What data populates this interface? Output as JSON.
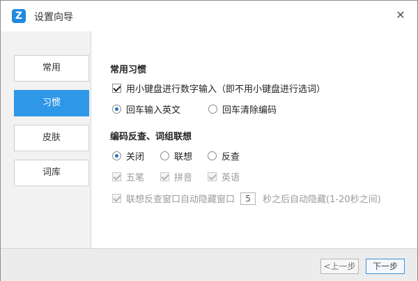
{
  "window": {
    "title": "设置向导",
    "logo_text": "Z",
    "close_glyph": "✕"
  },
  "sidebar": {
    "items": [
      {
        "label": "常用",
        "active": false
      },
      {
        "label": "习惯",
        "active": true
      },
      {
        "label": "皮肤",
        "active": false
      },
      {
        "label": "词库",
        "active": false
      }
    ]
  },
  "habits": {
    "title": "常用习惯",
    "numpad_option": {
      "label": "用小键盘进行数字输入（即不用小键盘进行选词）",
      "checked": true
    },
    "enter_english": {
      "label": "回车输入英文",
      "checked": true
    },
    "enter_clear": {
      "label": "回车清除编码",
      "checked": false
    }
  },
  "reverse": {
    "title": "编码反查、词组联想",
    "off": {
      "label": "关闭",
      "checked": true
    },
    "assoc": {
      "label": "联想",
      "checked": false
    },
    "lookup": {
      "label": "反查",
      "checked": false
    },
    "wubi": {
      "label": "五笔",
      "checked": true
    },
    "pinyin": {
      "label": "拼音",
      "checked": true
    },
    "english": {
      "label": "英语",
      "checked": true
    },
    "autohide": {
      "label": "联想反查窗口自动隐藏窗口",
      "value": "5",
      "suffix": "秒之后自动隐藏(1-20秒之间)",
      "checked": true
    }
  },
  "footer": {
    "prev_label": "<上一步",
    "next_label": "下一步"
  },
  "colors": {
    "accent": "#2f97e8",
    "sidebar_bg": "#f2f2f2",
    "footer_bg": "#ececec"
  }
}
